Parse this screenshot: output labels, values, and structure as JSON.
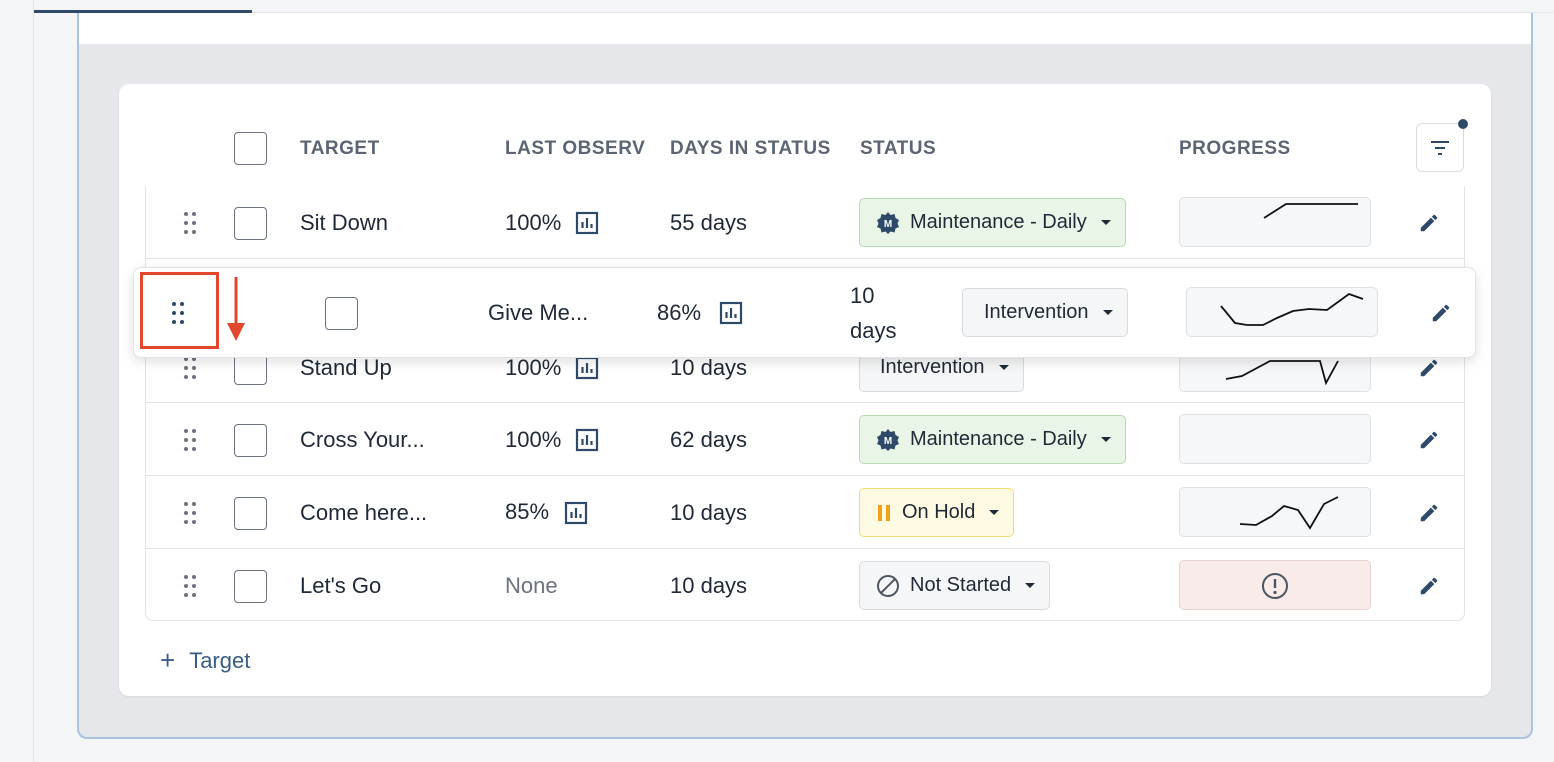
{
  "table": {
    "headers": {
      "target": "TARGET",
      "last_observ": "LAST OBSERV",
      "days_in_status": "DAYS IN STATUS",
      "status": "STATUS",
      "progress": "PROGRESS"
    },
    "rows": [
      {
        "target": "Sit Down",
        "last_observ": "100%",
        "days": "55 days",
        "status": "Maintenance - Daily",
        "status_badge": "M"
      },
      {
        "target": "Stand Up",
        "last_observ": "100%",
        "days": "10 days",
        "status": "Intervention"
      },
      {
        "target": "Cross Your...",
        "last_observ": "100%",
        "days": "62 days",
        "status": "Maintenance - Daily",
        "status_badge": "M"
      },
      {
        "target": "Come here...",
        "last_observ": "85%",
        "days": "10 days",
        "status": "On Hold"
      },
      {
        "target": "Let's Go",
        "last_observ": "None",
        "days": "10 days",
        "status": "Not Started"
      }
    ],
    "dragging_row": {
      "target": "Give Me...",
      "last_observ": "86%",
      "days_line1": "10",
      "days_line2": "days",
      "status": "Intervention"
    }
  },
  "actions": {
    "add_target_label": "Target"
  },
  "colors": {
    "accent": "#2f4a68",
    "highlight": "#e2482e",
    "maintenance_bg": "#e9f5e7",
    "on_hold_bg": "#fffbe3",
    "warning_bg": "#f9ebe9"
  },
  "icons": {
    "drag_handle": "grip-dots-icon",
    "observation": "bar-chart-icon",
    "edit": "pencil-icon",
    "filter": "filter-lines-icon",
    "add": "plus-icon",
    "maintenance": "badge-m-icon",
    "on_hold": "pause-icon",
    "not_started": "ban-icon",
    "no_progress": "alert-circle-icon",
    "drop_indicator": "arrow-down-icon"
  }
}
